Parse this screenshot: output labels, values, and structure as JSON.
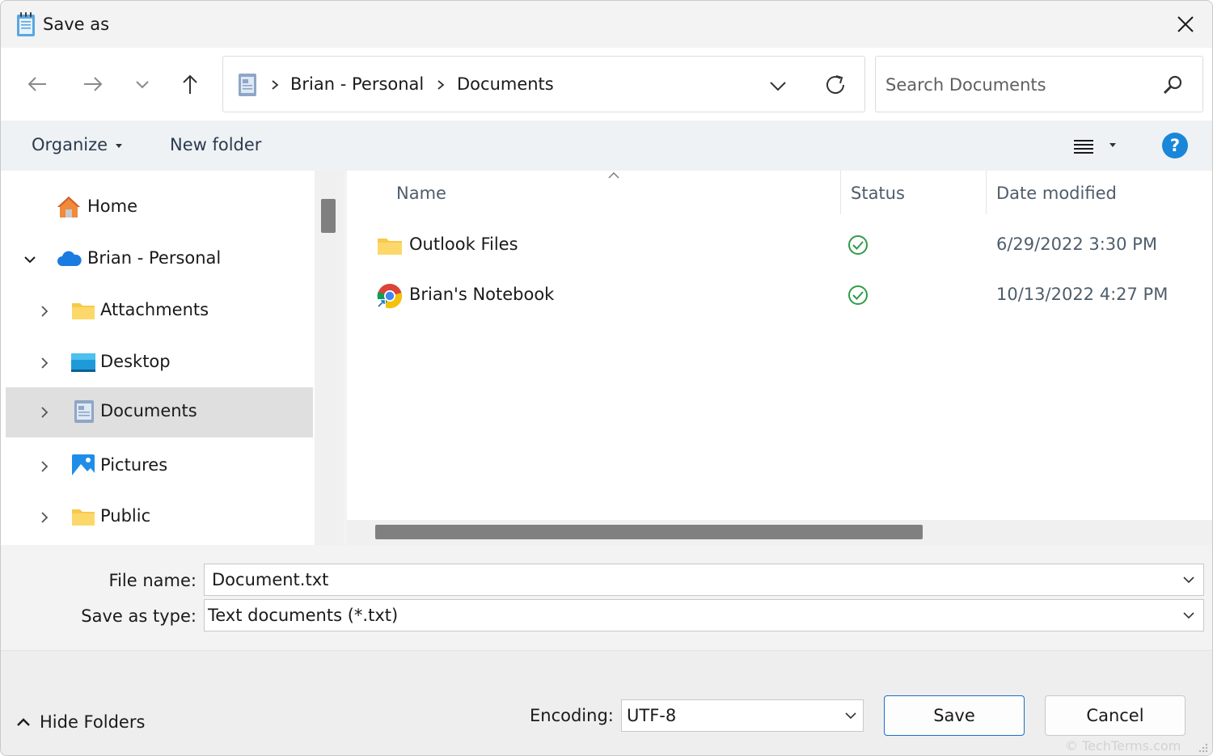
{
  "window": {
    "title": "Save as"
  },
  "address": {
    "crumbs": [
      "Brian - Personal",
      "Documents"
    ]
  },
  "search": {
    "placeholder": "Search Documents"
  },
  "toolbar": {
    "organize_label": "Organize",
    "new_folder_label": "New folder",
    "help_label": "?"
  },
  "sidebar": {
    "items": [
      {
        "label": "Home",
        "icon": "home-icon",
        "expandable": false,
        "expanded": false,
        "selected": false
      },
      {
        "label": "Brian - Personal",
        "icon": "onedrive-cloud-icon",
        "expandable": true,
        "expanded": true,
        "selected": false
      },
      {
        "label": "Attachments",
        "icon": "folder-icon",
        "expandable": true,
        "expanded": false,
        "selected": false
      },
      {
        "label": "Desktop",
        "icon": "desktop-icon",
        "expandable": true,
        "expanded": false,
        "selected": false
      },
      {
        "label": "Documents",
        "icon": "documents-icon",
        "expandable": true,
        "expanded": false,
        "selected": true
      },
      {
        "label": "Pictures",
        "icon": "pictures-icon",
        "expandable": true,
        "expanded": false,
        "selected": false
      },
      {
        "label": "Public",
        "icon": "folder-icon",
        "expandable": true,
        "expanded": false,
        "selected": false
      }
    ]
  },
  "filelist": {
    "columns": [
      "Name",
      "Status",
      "Date modified"
    ],
    "sort_column": "Name",
    "rows": [
      {
        "name": "Outlook Files",
        "icon": "folder-icon",
        "status": "synced-check-icon",
        "date": "6/29/2022 3:30 PM"
      },
      {
        "name": "Brian's Notebook",
        "icon": "chrome-shortcut-icon",
        "status": "synced-check-icon",
        "date": "10/13/2022 4:27 PM"
      }
    ]
  },
  "fields": {
    "file_name_label": "File name:",
    "file_name_value": "Document.txt",
    "save_type_label": "Save as type:",
    "save_type_value": "Text documents (*.txt)"
  },
  "footer": {
    "hide_folders_label": "Hide Folders",
    "encoding_label": "Encoding:",
    "encoding_value": "UTF-8",
    "save_label": "Save",
    "cancel_label": "Cancel",
    "watermark": "© TechTerms.com"
  },
  "colors": {
    "accent": "#1a86d9",
    "selected_bg": "#dfdfdf",
    "toolbar_bg": "#eef2f5",
    "status_green": "#2e9b48",
    "folder_yellow": "#f8c94a"
  }
}
